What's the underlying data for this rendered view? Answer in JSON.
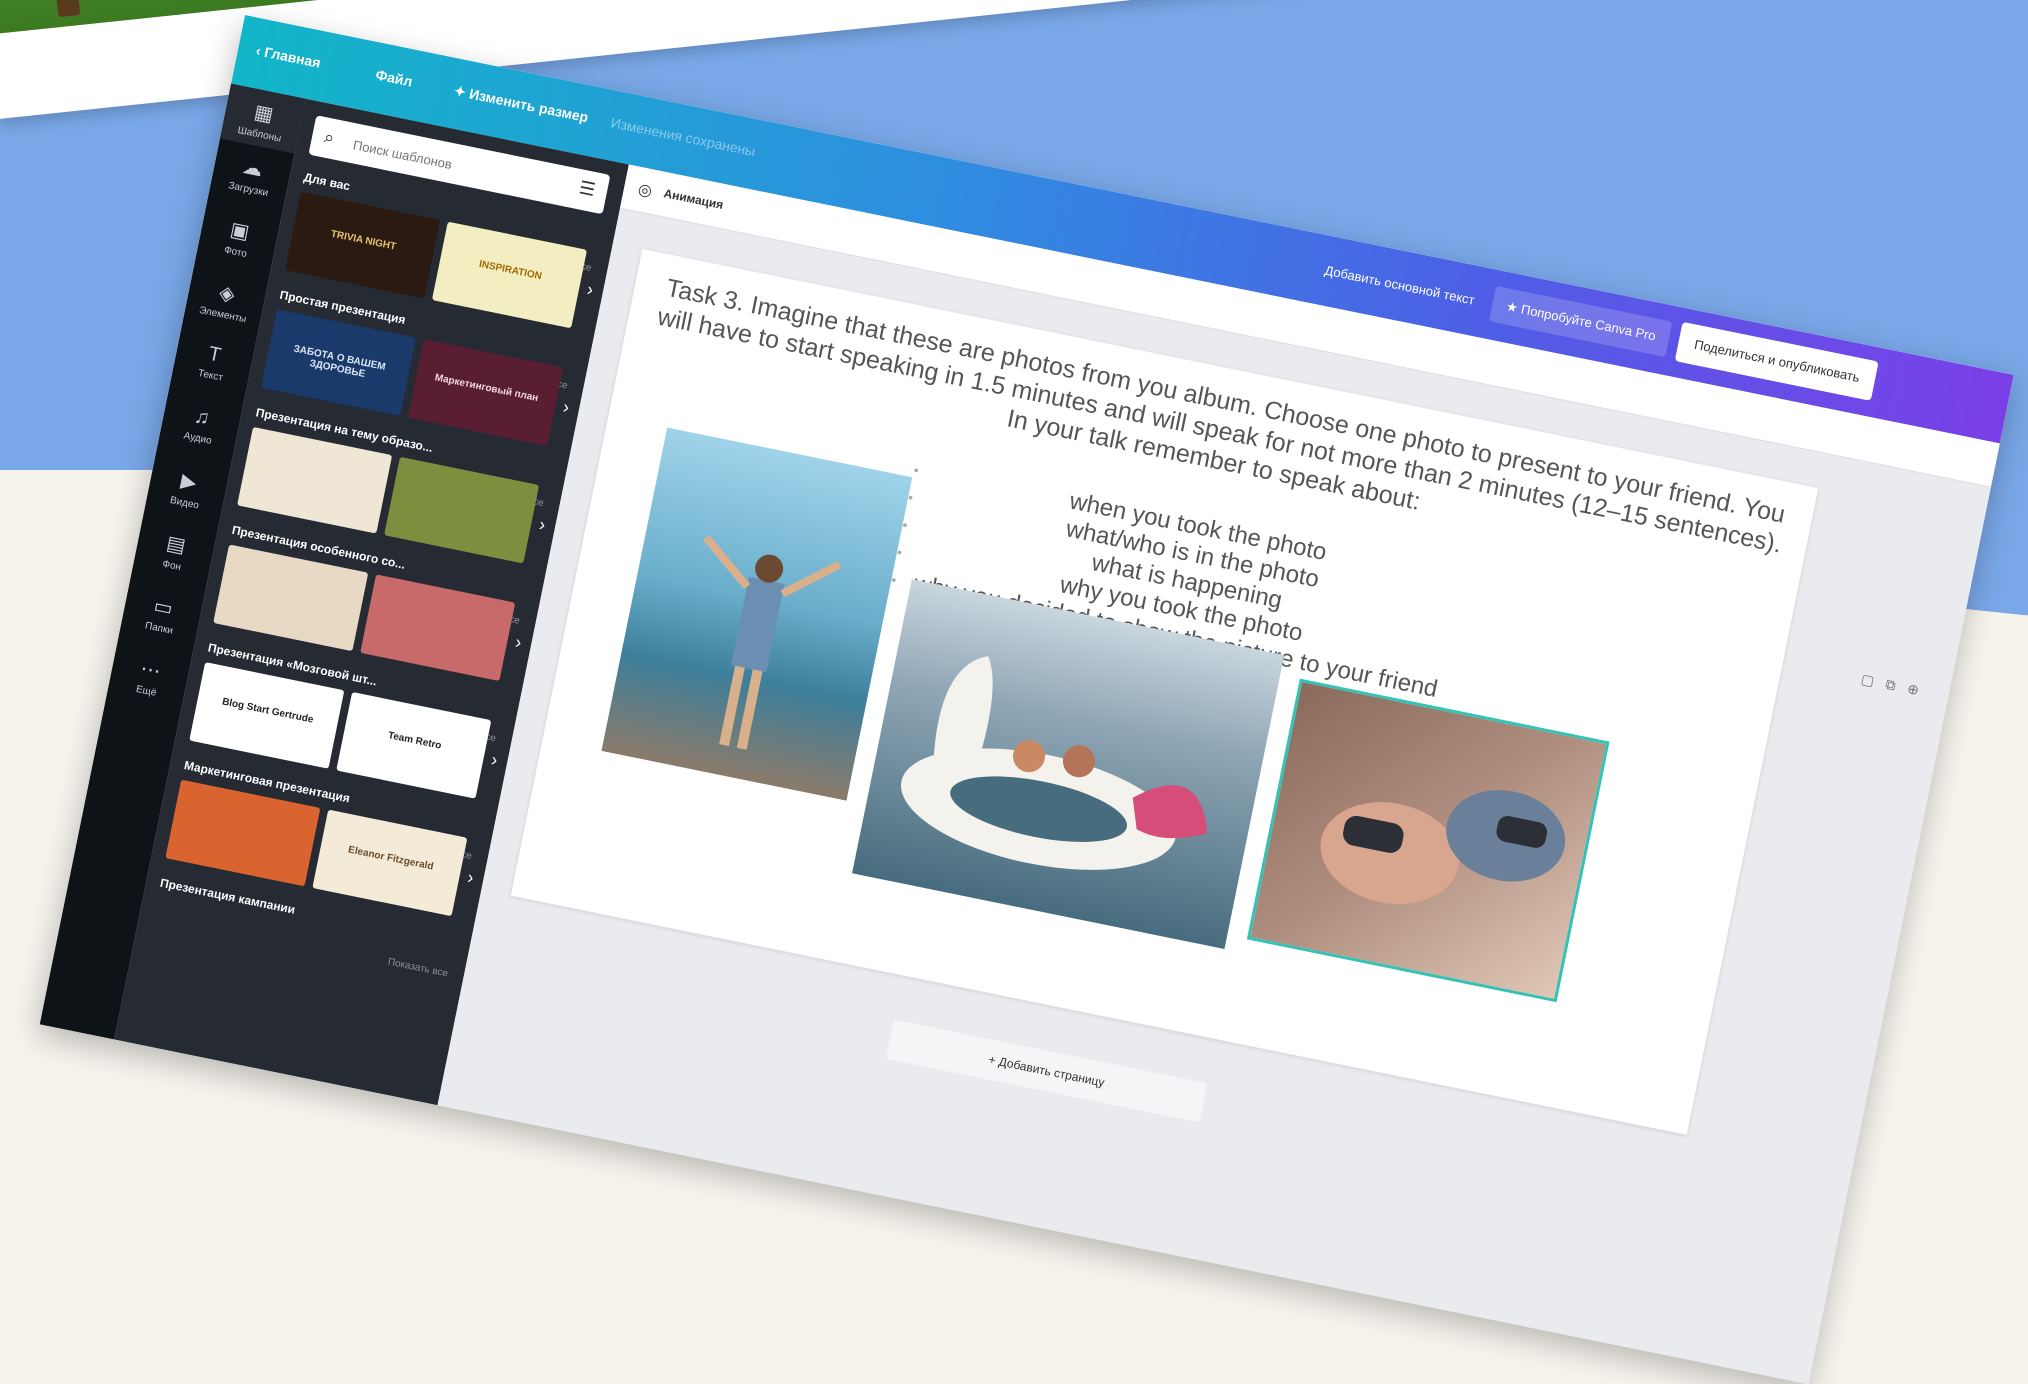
{
  "colors": {
    "accent_cyan": "#12b6c8",
    "accent_purple": "#7b3fe8",
    "panel_dark": "#252a33",
    "rail_dark": "#0e1318"
  },
  "topbar": {
    "back_label": "Главная",
    "file_label": "Файл",
    "resize_label": "Изменить размер",
    "saved_label": "Изменения сохранены",
    "alt_text_label": "Добавить основной текст",
    "pro_label": "Попробуйте Canva Pro",
    "share_label": "Поделиться и опубликовать"
  },
  "rail": [
    {
      "icon": "templates-icon",
      "label": "Шаблоны"
    },
    {
      "icon": "uploads-icon",
      "label": "Загрузки"
    },
    {
      "icon": "photos-icon",
      "label": "Фото"
    },
    {
      "icon": "elements-icon",
      "label": "Элементы"
    },
    {
      "icon": "text-icon",
      "label": "Текст"
    },
    {
      "icon": "audio-icon",
      "label": "Аудио"
    },
    {
      "icon": "video-icon",
      "label": "Видео"
    },
    {
      "icon": "background-icon",
      "label": "Фон"
    },
    {
      "icon": "folder-icon",
      "label": "Папки"
    },
    {
      "icon": "more-icon",
      "label": "Ещё"
    }
  ],
  "panel": {
    "search_placeholder": "Поиск шаблонов",
    "show_all": "Показать все",
    "sections": [
      {
        "title": "Для вас",
        "thumbs": [
          "TRIVIA NIGHT",
          "INSPIRATION"
        ]
      },
      {
        "title": "Простая презентация",
        "thumbs": [
          "ЗАБОТА О ВАШЕМ ЗДОРОВЬЕ",
          "Маркетинговый план"
        ]
      },
      {
        "title": "Презентация на тему образо...",
        "thumbs": [
          "",
          ""
        ]
      },
      {
        "title": "Презентация особенного со...",
        "thumbs": [
          "",
          ""
        ]
      },
      {
        "title": "Презентация «Мозговой шт...",
        "thumbs": [
          "Blog Start Gertrude",
          "Team Retro"
        ]
      },
      {
        "title": "Маркетинговая презентация",
        "thumbs": [
          "",
          "Eleanor Fitzgerald"
        ]
      },
      {
        "title": "Презентация кампании",
        "thumbs": []
      }
    ]
  },
  "canvas": {
    "animation_label": "Анимация",
    "task_text": "Task 3. Imagine that these are photos from you album. Choose one photo to present to your friend. You will have to start speaking in 1.5 minutes and will speak for not more than 2 minutes (12–15 sentences). In your talk remember to speak about:",
    "bullets": [
      "when you took the photo",
      "what/who is in the photo",
      "what is happening",
      "why you took the photo",
      "why you decided to show the picture to your friend"
    ],
    "photos": [
      "woman-at-sea-photo",
      "unicorn-float-photo",
      "kids-gaming-photo"
    ],
    "add_page_label": "+ Добавить страницу"
  }
}
